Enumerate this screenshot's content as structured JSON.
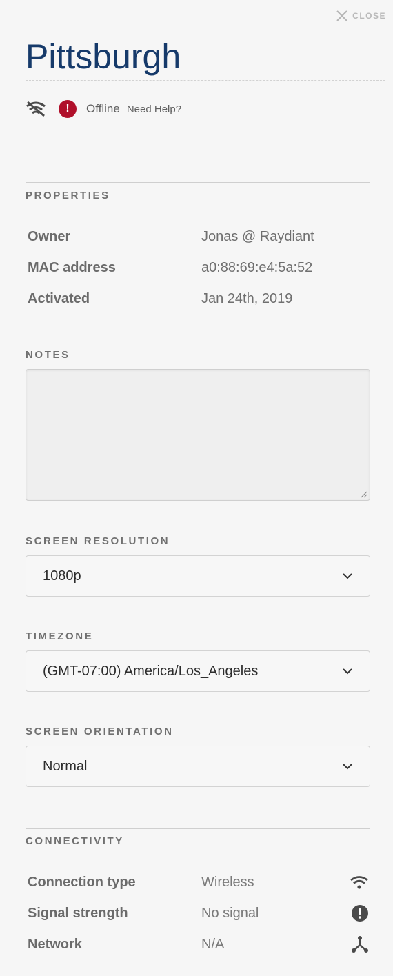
{
  "header": {
    "close_label": "CLOSE",
    "title": "Pittsburgh"
  },
  "status": {
    "text": "Offline",
    "help_link": "Need Help?",
    "badge_symbol": "!",
    "badge_color": "#b0102b"
  },
  "properties": {
    "heading": "PROPERTIES",
    "rows": [
      {
        "label": "Owner",
        "value": "Jonas @ Raydiant"
      },
      {
        "label": "MAC address",
        "value": "a0:88:69:e4:5a:52"
      },
      {
        "label": "Activated",
        "value": "Jan 24th, 2019"
      }
    ]
  },
  "notes": {
    "heading": "NOTES",
    "value": ""
  },
  "screen_resolution": {
    "heading": "SCREEN RESOLUTION",
    "selected": "1080p"
  },
  "timezone": {
    "heading": "TIMEZONE",
    "selected": "(GMT-07:00) America/Los_Angeles"
  },
  "screen_orientation": {
    "heading": "SCREEN ORIENTATION",
    "selected": "Normal"
  },
  "connectivity": {
    "heading": "CONNECTIVITY",
    "rows": [
      {
        "label": "Connection type",
        "value": "Wireless",
        "icon": "wifi-icon"
      },
      {
        "label": "Signal strength",
        "value": "No signal",
        "icon": "alert-icon"
      },
      {
        "label": "Network",
        "value": "N/A",
        "icon": "network-icon"
      }
    ]
  },
  "colors": {
    "title": "#163a6a",
    "background": "#f6f6f6"
  }
}
